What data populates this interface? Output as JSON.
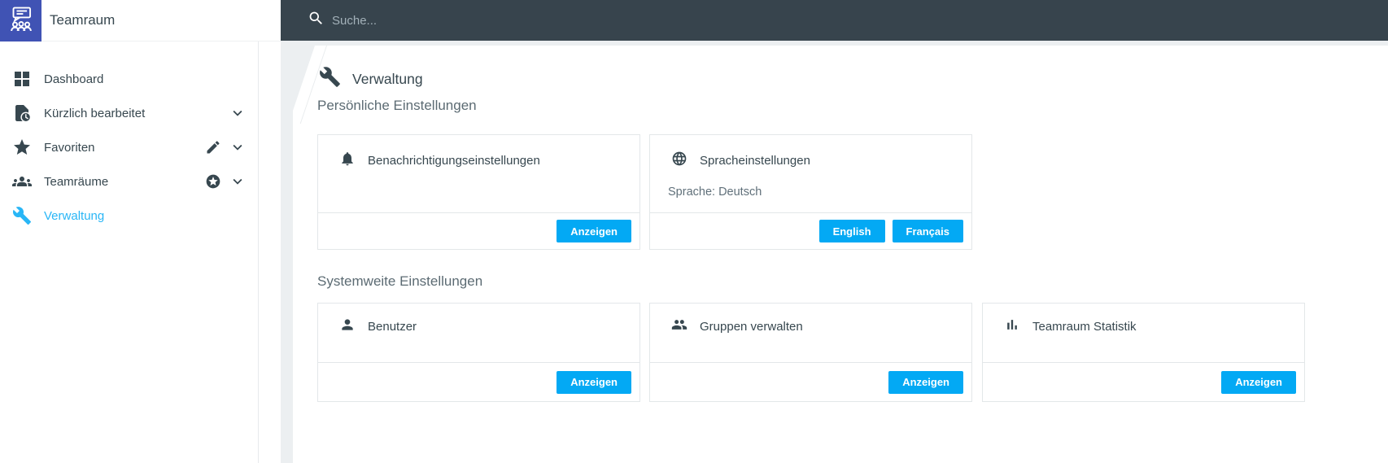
{
  "app": {
    "title": "Teamraum",
    "search_placeholder": "Suche..."
  },
  "colors": {
    "accent_button": "#03A9F4",
    "active_nav": "#29B6F6",
    "topbar": "#37444D",
    "logo": "#4053B4",
    "page_background": "#ECEFF1",
    "text_dark": "#37474F"
  },
  "sidebar": {
    "items": [
      {
        "label": "Dashboard",
        "icon": "dashboard-grid-icon",
        "active": false,
        "expandable": false
      },
      {
        "label": "Kürzlich bearbeitet",
        "icon": "recent-document-clock-icon",
        "active": false,
        "expandable": true
      },
      {
        "label": "Favoriten",
        "icon": "star-icon",
        "active": false,
        "expandable": true,
        "secondary_icon": "edit-pencil-icon"
      },
      {
        "label": "Teamräume",
        "icon": "groups-icon",
        "active": false,
        "expandable": true,
        "secondary_icon": "star-circle-icon"
      },
      {
        "label": "Verwaltung",
        "icon": "wrench-icon",
        "active": true,
        "expandable": false
      }
    ]
  },
  "main": {
    "title": "Verwaltung",
    "title_icon": "wrench-icon",
    "sections": [
      {
        "heading": "Persönliche Einstellungen",
        "cards": [
          {
            "title": "Benachrichtigungseinstellungen",
            "icon": "bell-icon",
            "buttons": [
              {
                "label": "Anzeigen"
              }
            ]
          },
          {
            "title": "Spracheinstellungen",
            "icon": "globe-icon",
            "body": "Sprache: Deutsch",
            "buttons": [
              {
                "label": "English"
              },
              {
                "label": "Français"
              }
            ]
          }
        ]
      },
      {
        "heading": "Systemweite Einstellungen",
        "cards": [
          {
            "title": "Benutzer",
            "icon": "person-icon",
            "buttons": [
              {
                "label": "Anzeigen"
              }
            ]
          },
          {
            "title": "Gruppen verwalten",
            "icon": "people-icon",
            "buttons": [
              {
                "label": "Anzeigen"
              }
            ]
          },
          {
            "title": "Teamraum Statistik",
            "icon": "bar-chart-icon",
            "buttons": [
              {
                "label": "Anzeigen"
              }
            ]
          }
        ]
      }
    ]
  }
}
